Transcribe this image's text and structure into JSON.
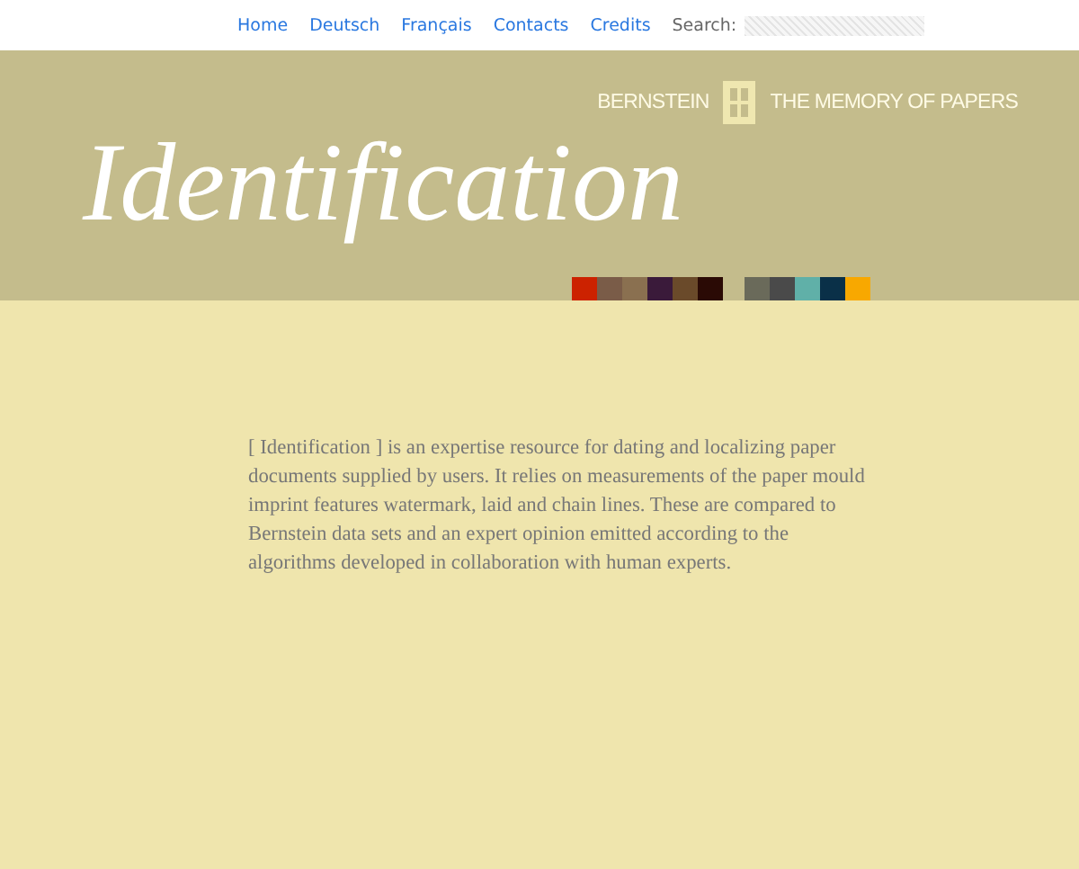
{
  "nav": {
    "links": [
      "Home",
      "Deutsch",
      "Français",
      "Contacts",
      "Credits"
    ],
    "search_label": "Search:"
  },
  "header": {
    "brand_left": "BERNSTEIN",
    "brand_right": "THE MEMORY OF PAPERS",
    "title": "Identification",
    "swatch_groups": [
      [
        {
          "color": "#cc2200"
        },
        {
          "color": "#7a5c48"
        },
        {
          "color": "#8a7050"
        },
        {
          "color": "#3a1a3a"
        },
        {
          "color": "#6a4a2a"
        },
        {
          "color": "#2a0a05"
        }
      ],
      [
        {
          "color": "#6a6a5a"
        },
        {
          "color": "#4a4a4a"
        },
        {
          "color": "#60b0a8"
        },
        {
          "color": "#0a3048"
        },
        {
          "color": "#f8a800"
        }
      ]
    ]
  },
  "intro": "[ Identification ] is an expertise resource for dating and localizing paper documents supplied by users. It relies on measurements of the paper mould imprint features watermark, laid and chain lines. These are compared to Bernstein data sets and an expert opinion emitted according to the algorithms developed in collaboration with human experts."
}
